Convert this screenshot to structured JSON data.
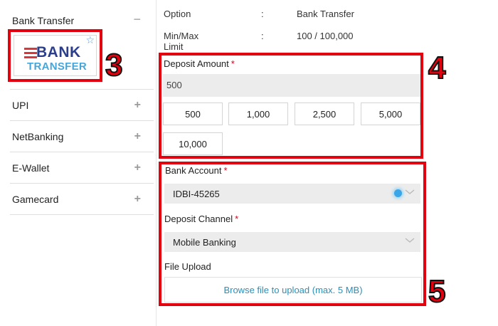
{
  "sidebar": {
    "active_method": {
      "label": "Bank Transfer",
      "toggle": "−"
    },
    "logo": {
      "line1": "BANK",
      "line2": "TRANSFER"
    },
    "methods": [
      {
        "label": "UPI",
        "toggle": "+"
      },
      {
        "label": "NetBanking",
        "toggle": "+"
      },
      {
        "label": "E-Wallet",
        "toggle": "+"
      },
      {
        "label": "Gamecard",
        "toggle": "+"
      }
    ]
  },
  "callouts": {
    "three": "3",
    "four": "4",
    "five": "5"
  },
  "info": {
    "option": {
      "label": "Option",
      "sep": ":",
      "value": "Bank Transfer"
    },
    "limit": {
      "label": "Min/Max Limit",
      "sep": ":",
      "value": "100 / 100,000"
    }
  },
  "deposit": {
    "label": "Deposit Amount",
    "required": "*",
    "value": "500",
    "presets": [
      "500",
      "1,000",
      "2,500",
      "5,000",
      "10,000"
    ]
  },
  "bank_account": {
    "label": "Bank Account",
    "required": "*",
    "selected": "IDBI-45265"
  },
  "deposit_channel": {
    "label": "Deposit Channel",
    "required": "*",
    "selected": "Mobile Banking"
  },
  "file_upload": {
    "label": "File Upload",
    "button": "Browse file to upload (max. 5 MB)"
  },
  "colors": {
    "highlight": "#e3000f",
    "link": "#2b8fb8",
    "field_bg": "#ececec"
  }
}
